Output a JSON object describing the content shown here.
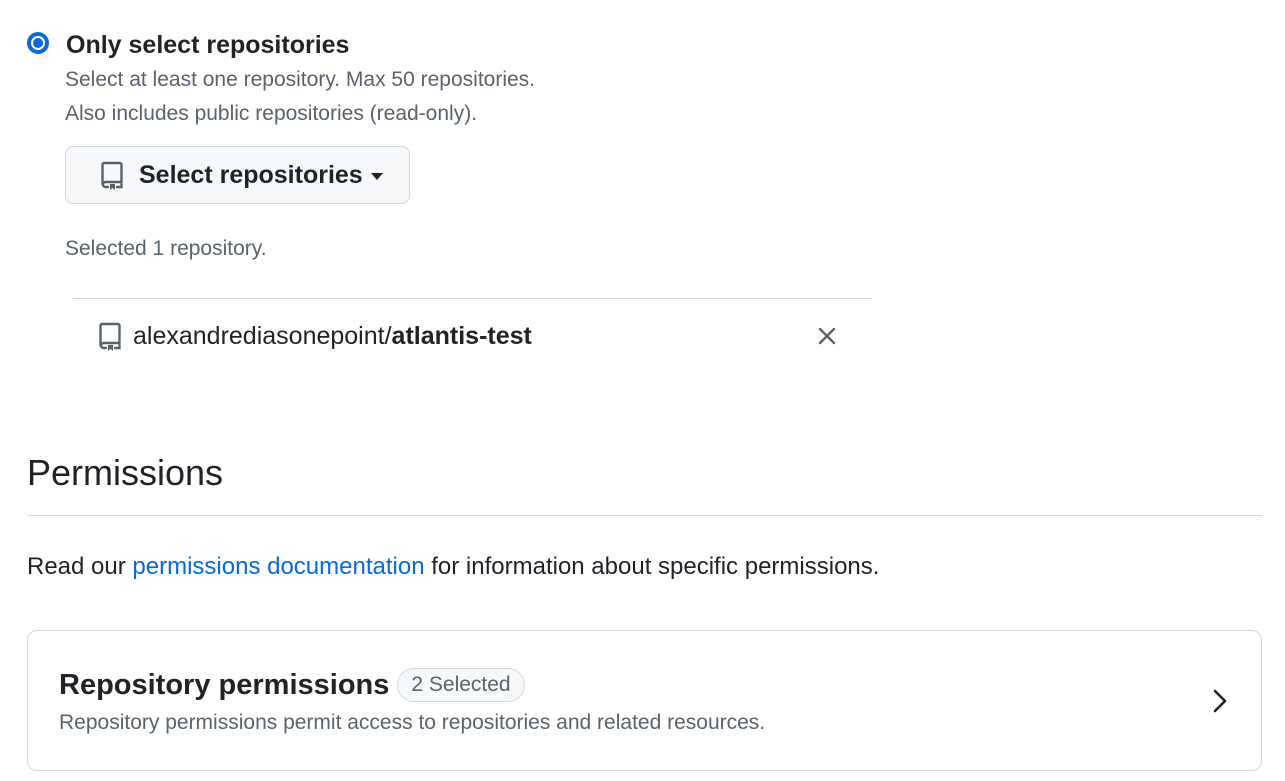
{
  "repo_access": {
    "option_label": "Only select repositories",
    "description_line1": "Select at least one repository. Max 50 repositories.",
    "description_line2": "Also includes public repositories (read-only).",
    "select_button_label": "Select repositories",
    "selected_count_text": "Selected 1 repository.",
    "selected_repos": [
      {
        "owner": "alexandrediasonepoint/",
        "name": "atlantis-test"
      }
    ]
  },
  "permissions": {
    "heading": "Permissions",
    "doc_prefix": "Read our",
    "doc_link_text": "permissions documentation",
    "doc_suffix": "for information about specific permissions.",
    "repository_card": {
      "title": "Repository permissions",
      "badge": "2 Selected",
      "description": "Repository permissions permit access to repositories and related resources."
    }
  },
  "icons": {
    "radio": "radio-selected-icon",
    "repo": "repo-icon",
    "caret": "caret-down-icon",
    "remove": "x-icon",
    "chevron": "chevron-right-icon"
  },
  "colors": {
    "accent": "#0969da",
    "muted_text": "#59636e",
    "border": "#d1d9e0"
  }
}
